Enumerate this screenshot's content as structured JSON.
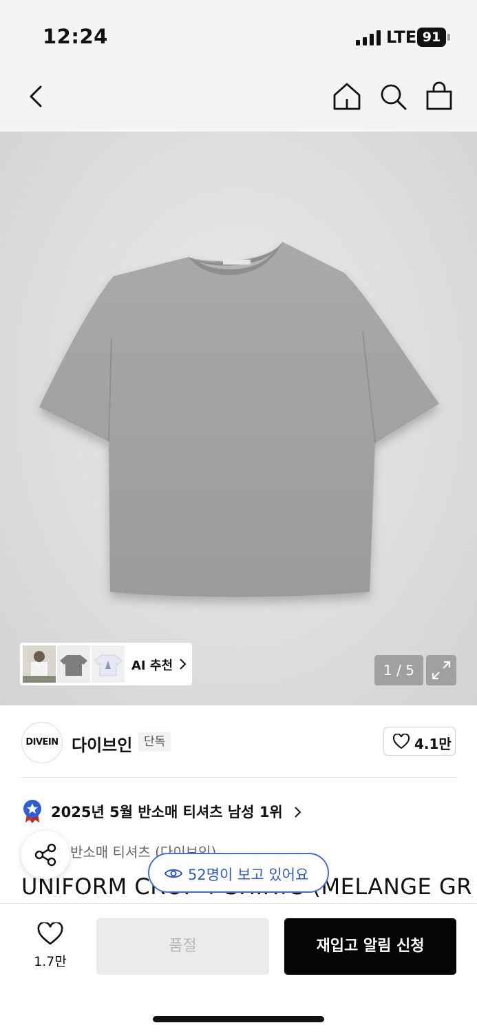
{
  "status_bar": {
    "time": "12:24",
    "network": "LTE",
    "battery": "91"
  },
  "nav": {
    "back_icon": "chevron-left-icon",
    "home_icon": "home-icon",
    "search_icon": "search-icon",
    "cart_icon": "shopping-bag-icon"
  },
  "gallery": {
    "ai_recommend_label": "AI 추천",
    "counter": "1 / 5",
    "fullscreen_icon": "expand-icon",
    "current_image": 1,
    "total_images": 5
  },
  "brand": {
    "logo_text": "DIVEIN",
    "name": "다이브인",
    "badge": "단독",
    "like_count": "4.1만"
  },
  "ranking": {
    "text": "2025년 5월 반소매 티셔츠 남성 1위"
  },
  "product": {
    "category": "반소매 티셔츠 (다이브인)",
    "title": "UNIFORM CROP T-SHIRTS (MELANGE GR"
  },
  "viewers": {
    "text": "52명이 보고 있어요"
  },
  "bottom_bar": {
    "wish_count": "1.7만",
    "soldout_label": "품절",
    "restock_label": "재입고 알림 신청"
  },
  "colors": {
    "accent_blue": "#2d5cc8",
    "primary_button": "#050505",
    "disabled_button": "#ebebeb"
  }
}
